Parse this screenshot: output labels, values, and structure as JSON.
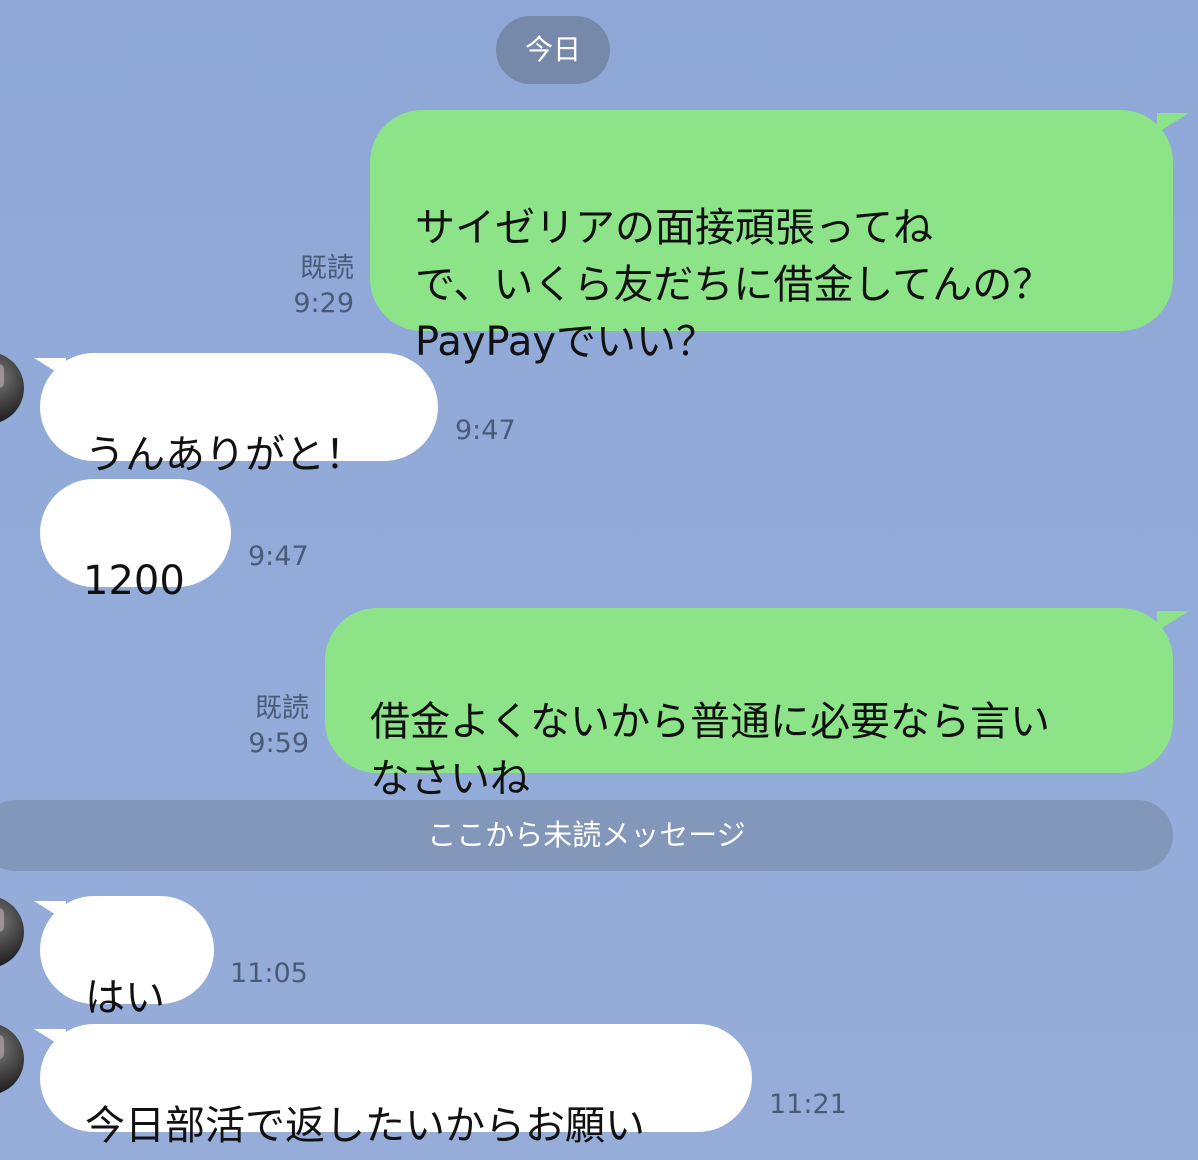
{
  "chat": {
    "date_label": "今日",
    "unread_label": "ここから未読メッセージ",
    "messages": [
      {
        "direction": "sent",
        "text": "サイゼリアの面接頑張ってね\nで、いくら友だちに借金してんの？\nPayPayでいい？",
        "read": "既読",
        "time": "9:29"
      },
      {
        "direction": "received",
        "text": "うんありがと！",
        "time": "9:47"
      },
      {
        "direction": "received",
        "text": "1200",
        "time": "9:47"
      },
      {
        "direction": "sent",
        "text": "借金よくないから普通に必要なら言い\nなさいね",
        "read": "既読",
        "time": "9:59"
      },
      {
        "direction": "received",
        "text": "はい",
        "time": "11:05"
      },
      {
        "direction": "received",
        "text": "今日部活で返したいからお願い",
        "time": "11:21"
      }
    ]
  },
  "colors": {
    "background": "#93abd9",
    "sent_bubble": "#8de388",
    "received_bubble": "#ffffff",
    "pill": "#7789aa",
    "meta_text": "#4a5b78"
  }
}
